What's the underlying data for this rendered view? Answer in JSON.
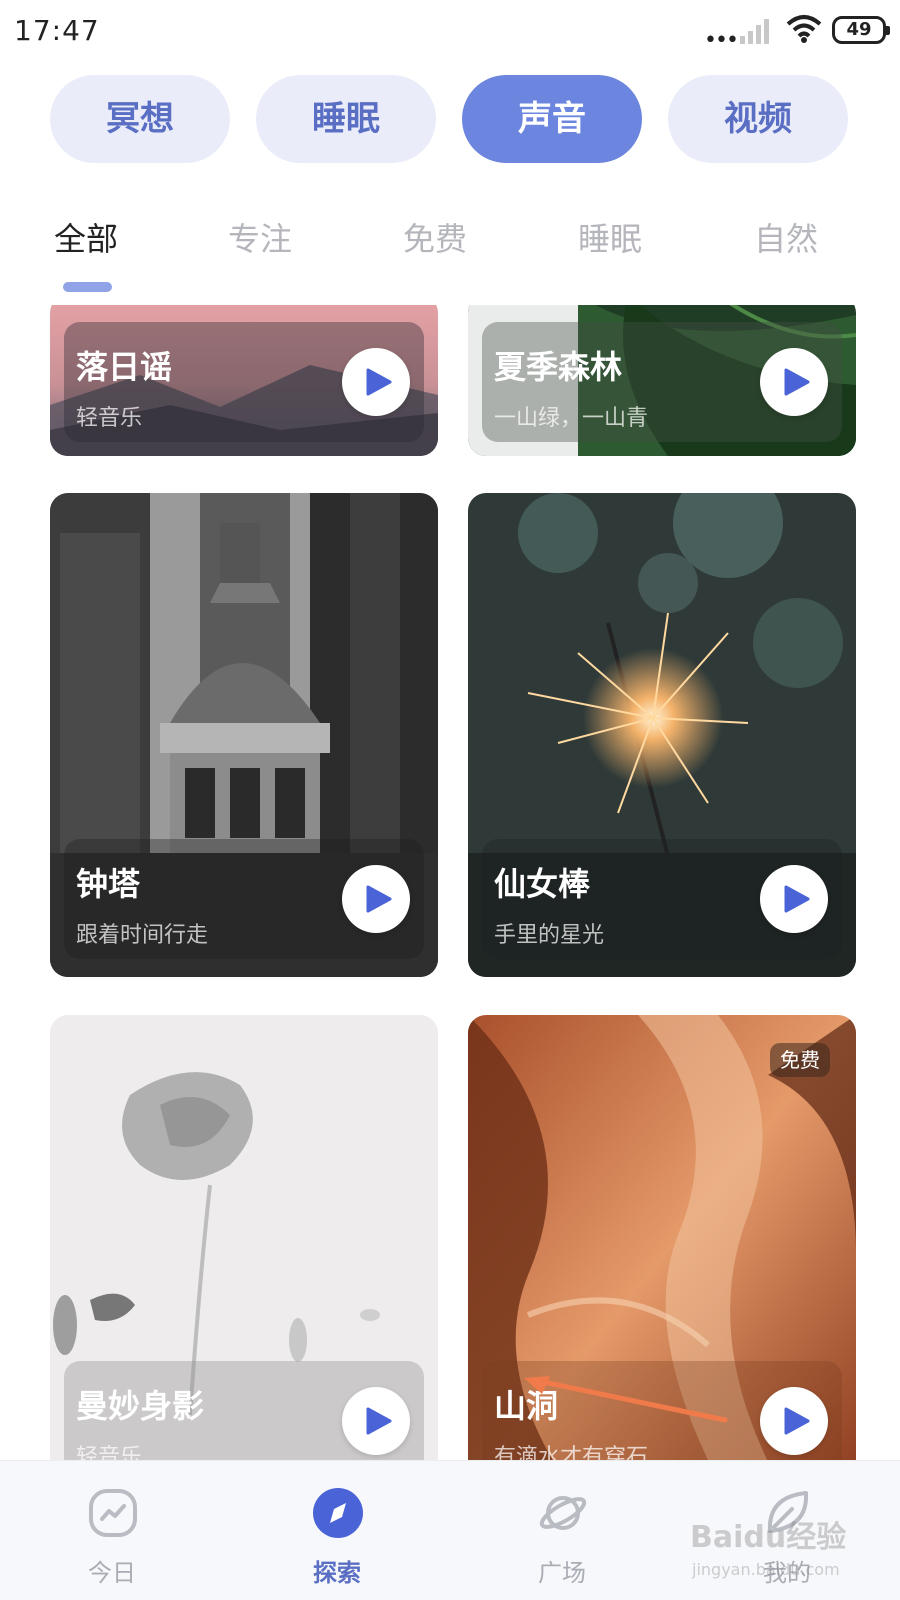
{
  "status_bar": {
    "time": "17:47",
    "dots": "•••",
    "battery": "49"
  },
  "categories": [
    {
      "label": "冥想",
      "active": false
    },
    {
      "label": "睡眠",
      "active": false
    },
    {
      "label": "声音",
      "active": true
    },
    {
      "label": "视频",
      "active": false
    }
  ],
  "sub_tabs": [
    {
      "label": "全部",
      "active": true
    },
    {
      "label": "专注",
      "active": false
    },
    {
      "label": "免费",
      "active": false
    },
    {
      "label": "睡眠",
      "active": false
    },
    {
      "label": "自然",
      "active": false
    }
  ],
  "cards": [
    {
      "title": "落日谣",
      "subtitle": "轻音乐",
      "image": "sunset-mountain"
    },
    {
      "title": "夏季森林",
      "subtitle": "一山绿，一山青",
      "image": "green-leaves"
    },
    {
      "title": "钟塔",
      "subtitle": "跟着时间行走",
      "image": "clock-tower"
    },
    {
      "title": "仙女棒",
      "subtitle": "手里的星光",
      "image": "sparkler"
    },
    {
      "title": "曼妙身影",
      "subtitle": "轻音乐",
      "image": "white-flower"
    },
    {
      "title": "山洞",
      "subtitle": "有滴水才有穿石",
      "image": "canyon",
      "badge": "免费"
    }
  ],
  "bottom_nav": [
    {
      "label": "今日",
      "icon": "trend-icon",
      "active": false
    },
    {
      "label": "探索",
      "icon": "compass-icon",
      "active": true
    },
    {
      "label": "广场",
      "icon": "planet-icon",
      "active": false
    },
    {
      "label": "我的",
      "icon": "leaf-icon",
      "active": false
    }
  ],
  "watermark": {
    "text": "Baidu经验",
    "sub": "jingyan.baidu.com"
  },
  "colors": {
    "accent": "#6c85de",
    "pill_bg": "#eaedf9",
    "play_icon": "#4a63d6",
    "annotation": "#f07a4a"
  }
}
